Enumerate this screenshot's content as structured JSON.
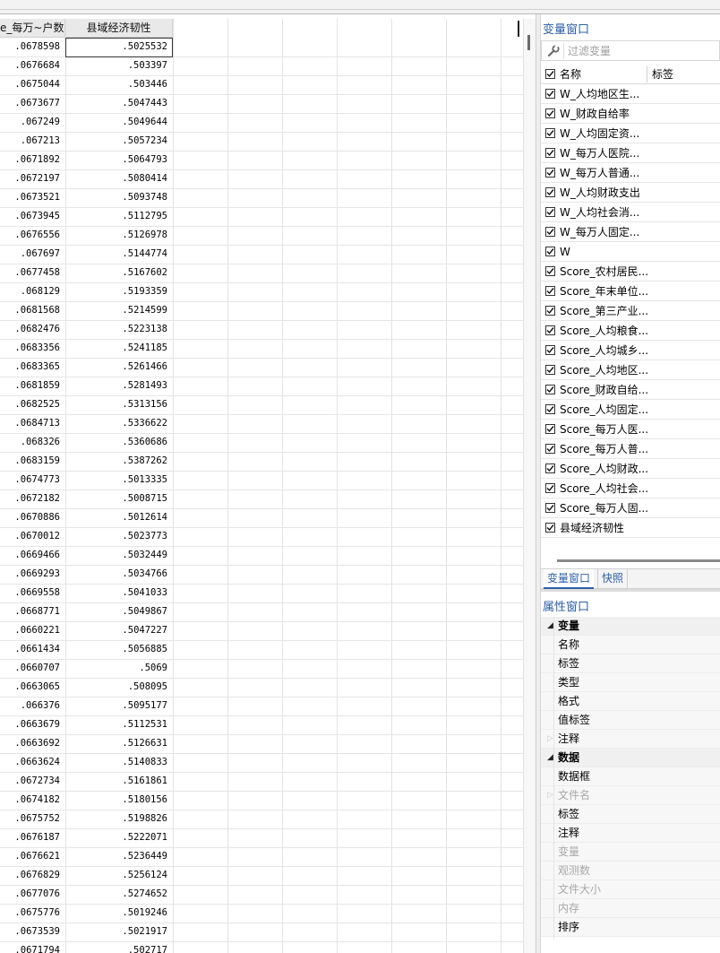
{
  "grid": {
    "headers": [
      "e_每万~户数",
      "县域经济韧性"
    ],
    "rows": [
      [
        ".0678598",
        ".5025532"
      ],
      [
        ".0676684",
        ".503397"
      ],
      [
        ".0675044",
        ".503446"
      ],
      [
        ".0673677",
        ".5047443"
      ],
      [
        ".067249",
        ".5049644"
      ],
      [
        ".067213",
        ".5057234"
      ],
      [
        ".0671892",
        ".5064793"
      ],
      [
        ".0672197",
        ".5080414"
      ],
      [
        ".0673521",
        ".5093748"
      ],
      [
        ".0673945",
        ".5112795"
      ],
      [
        ".0676556",
        ".5126978"
      ],
      [
        ".067697",
        ".5144774"
      ],
      [
        ".0677458",
        ".5167602"
      ],
      [
        ".068129",
        ".5193359"
      ],
      [
        ".0681568",
        ".5214599"
      ],
      [
        ".0682476",
        ".5223138"
      ],
      [
        ".0683356",
        ".5241185"
      ],
      [
        ".0683365",
        ".5261466"
      ],
      [
        ".0681859",
        ".5281493"
      ],
      [
        ".0682525",
        ".5313156"
      ],
      [
        ".0684713",
        ".5336622"
      ],
      [
        ".068326",
        ".5360686"
      ],
      [
        ".0683159",
        ".5387262"
      ],
      [
        ".0674773",
        ".5013335"
      ],
      [
        ".0672182",
        ".5008715"
      ],
      [
        ".0670886",
        ".5012614"
      ],
      [
        ".0670012",
        ".5023773"
      ],
      [
        ".0669466",
        ".5032449"
      ],
      [
        ".0669293",
        ".5034766"
      ],
      [
        ".0669558",
        ".5041033"
      ],
      [
        ".0668771",
        ".5049867"
      ],
      [
        ".0660221",
        ".5047227"
      ],
      [
        ".0661434",
        ".5056885"
      ],
      [
        ".0660707",
        ".5069"
      ],
      [
        ".0663065",
        ".508095"
      ],
      [
        ".066376",
        ".5095177"
      ],
      [
        ".0663679",
        ".5112531"
      ],
      [
        ".0663692",
        ".5126631"
      ],
      [
        ".0663624",
        ".5140833"
      ],
      [
        ".0672734",
        ".5161861"
      ],
      [
        ".0674182",
        ".5180156"
      ],
      [
        ".0675752",
        ".5198826"
      ],
      [
        ".0676187",
        ".5222071"
      ],
      [
        ".0676621",
        ".5236449"
      ],
      [
        ".0676829",
        ".5256124"
      ],
      [
        ".0677076",
        ".5274652"
      ],
      [
        ".0675776",
        ".5019246"
      ],
      [
        ".0673539",
        ".5021917"
      ],
      [
        ".0671794",
        ".502717"
      ]
    ]
  },
  "variables_window": {
    "title": "变量窗口",
    "filter_placeholder": "过滤变量",
    "col_name": "名称",
    "col_label": "标签",
    "items": [
      "W_人均地区生...",
      "W_财政自给率",
      "W_人均固定资...",
      "W_每万人医院...",
      "W_每万人普通...",
      "W_人均财政支出",
      "W_人均社会消...",
      "W_每万人固定...",
      "W",
      "Score_农村居民...",
      "Score_年末单位...",
      "Score_第三产业...",
      "Score_人均粮食...",
      "Score_人均城乡...",
      "Score_人均地区...",
      "Score_财政自给...",
      "Score_人均固定...",
      "Score_每万人医...",
      "Score_每万人普...",
      "Score_人均财政...",
      "Score_人均社会...",
      "Score_每万人固...",
      "县域经济韧性"
    ]
  },
  "tabs": [
    "变量窗口",
    "快照"
  ],
  "properties_window": {
    "title": "属性窗口",
    "rows": [
      {
        "label": "变量",
        "group": true
      },
      {
        "label": "名称"
      },
      {
        "label": "标签"
      },
      {
        "label": "类型"
      },
      {
        "label": "格式"
      },
      {
        "label": "值标签"
      },
      {
        "label": "注释",
        "expand": true
      },
      {
        "label": "数据",
        "group": true
      },
      {
        "label": "数据框"
      },
      {
        "label": "文件名",
        "dim": true,
        "expand": true
      },
      {
        "label": "标签"
      },
      {
        "label": "注释"
      },
      {
        "label": "变量",
        "dim": true
      },
      {
        "label": "观测数",
        "dim": true
      },
      {
        "label": "文件大小",
        "dim": true
      },
      {
        "label": "内存",
        "dim": true
      },
      {
        "label": "排序"
      }
    ]
  }
}
